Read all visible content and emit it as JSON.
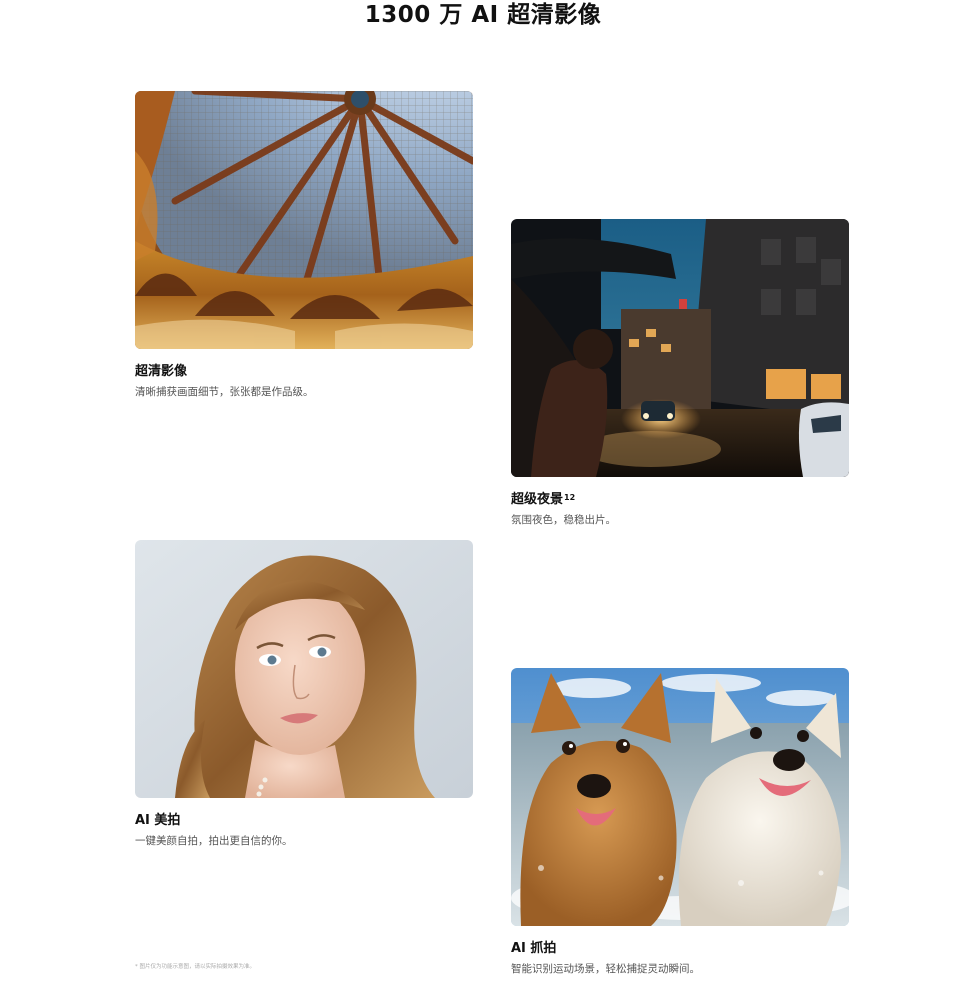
{
  "page": {
    "title": "1300 万 AI 超清影像"
  },
  "cards": [
    {
      "id": "hd",
      "title": "超清影像",
      "superscript": "",
      "desc": "清晰捕获画面细节，张张都是作品级。",
      "photo_icon": "stained-glass-dome-photo"
    },
    {
      "id": "night",
      "title": "超级夜景",
      "superscript": "12",
      "desc": "氛围夜色，稳稳出片。",
      "photo_icon": "night-street-photo"
    },
    {
      "id": "beauty",
      "title": "AI 美拍",
      "superscript": "",
      "desc": "一键美颜自拍，拍出更自信的你。",
      "photo_icon": "portrait-photo"
    },
    {
      "id": "snap",
      "title": "AI 抓拍",
      "superscript": "",
      "desc": "智能识别运动场景，轻松捕捉灵动瞬间。",
      "photo_icon": "running-dogs-photo"
    }
  ],
  "footnote": "* 图片仅为功能示意图，请以实际拍摄效果为准。",
  "colors": {
    "text_primary": "#111111",
    "text_secondary": "#555555",
    "footnote": "#aaaaaa",
    "background": "#ffffff"
  }
}
